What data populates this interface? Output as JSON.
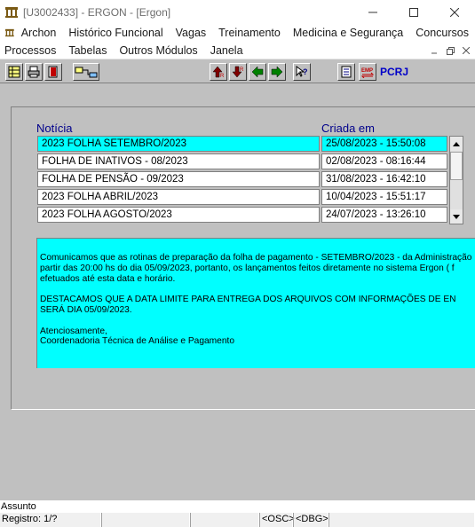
{
  "window": {
    "title": "[U3002433] - ERGON - [Ergon]",
    "controls": [
      "minimize",
      "maximize",
      "close"
    ]
  },
  "menu_row1": [
    "Archon",
    "Histórico Funcional",
    "Vagas",
    "Treinamento",
    "Medicina e Segurança",
    "Concursos"
  ],
  "menu_row2": [
    "Processos",
    "Tabelas",
    "Outros Módulos",
    "Janela"
  ],
  "toolbar": {
    "label": "PCRJ"
  },
  "grid": {
    "headers": {
      "noticia": "Notícia",
      "criada_em": "Criada em"
    },
    "rows": [
      {
        "noticia": " 2023 FOLHA SETEMBRO/2023",
        "criada_em": "25/08/2023  -  15:50:08",
        "selected": true
      },
      {
        "noticia": "FOLHA DE INATIVOS - 08/2023",
        "criada_em": "02/08/2023  -  08:16:44",
        "selected": false
      },
      {
        "noticia": "FOLHA DE PENSÃO  - 09/2023",
        "criada_em": "31/08/2023  -  16:42:10",
        "selected": false
      },
      {
        "noticia": "2023 FOLHA ABRIL/2023",
        "criada_em": "10/04/2023  -  15:51:17",
        "selected": false
      },
      {
        "noticia": "2023 FOLHA AGOSTO/2023",
        "criada_em": "24/07/2023  -  13:26:10",
        "selected": false
      }
    ]
  },
  "message": {
    "text": "Comunicamos que as rotinas de preparação da folha de pagamento - SETEMBRO/2023 - da Administração\npartir das 20:00 hs do dia 05/09/2023, portanto, os lançamentos feitos diretamente no sistema Ergon ( f\nefetuados até esta data e horário.\n\nDESTACAMOS QUE A DATA LIMITE PARA ENTREGA DOS ARQUIVOS COM INFORMAÇÕES DE EN\nSERÁ DIA 05/09/2023.\n\nAtenciosamente,\nCoordenadoria Técnica de Análise e Pagamento"
  },
  "status": {
    "assunto": "Assunto",
    "registro": "Registro: 1/?",
    "osc": "<OSC>",
    "dbg": "<DBG>"
  },
  "colors": {
    "selection": "#00ffff",
    "header_text": "#00008b",
    "toolbar_label": "#0000c8",
    "background": "#c0c0c0"
  }
}
